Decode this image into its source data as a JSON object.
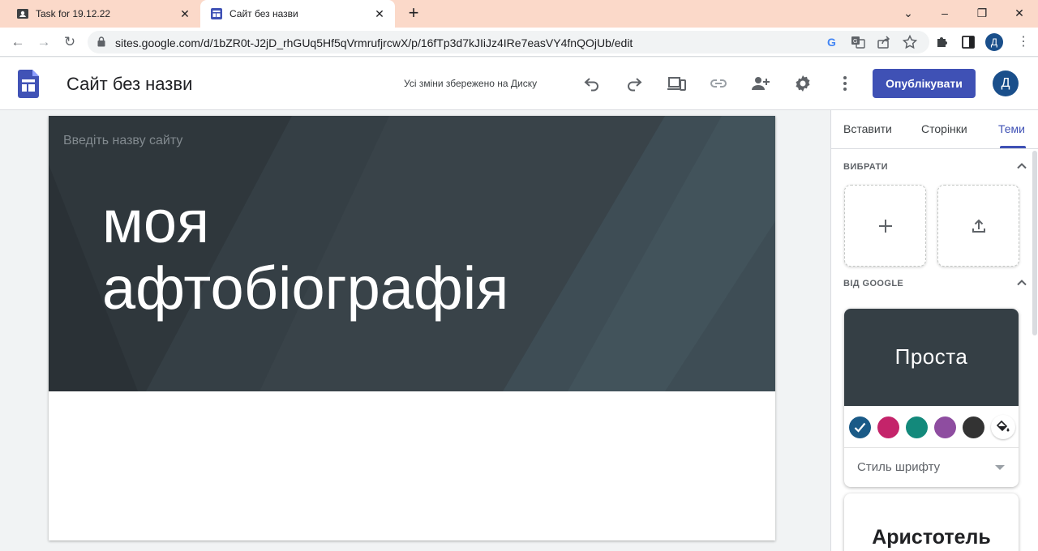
{
  "browser": {
    "tabs": [
      {
        "title": "Task for 19.12.22",
        "active": false
      },
      {
        "title": "Сайт без назви",
        "active": true
      }
    ],
    "url": "sites.google.com/d/1bZR0t-J2jD_rhGUq5Hf5qVrmrufjrcwX/p/16fTp3d7kJIiJz4IRe7easVY4fnQOjUb/edit",
    "profile_initial": "Д"
  },
  "app": {
    "site_title": "Сайт без назви",
    "save_status": "Усі зміни збережено на Диску",
    "publish_label": "Опублікувати",
    "profile_initial": "Д"
  },
  "canvas": {
    "site_name_placeholder": "Введіть назву сайту",
    "hero_line1": "моя",
    "hero_line2": "афтобіографія"
  },
  "panel": {
    "tabs": [
      {
        "label": "Вставити",
        "active": false
      },
      {
        "label": "Сторінки",
        "active": false
      },
      {
        "label": "Теми",
        "active": true
      }
    ],
    "section_choose": "ВИБРАТИ",
    "section_google": "ВІД GOOGLE",
    "themes": [
      {
        "name": "Проста",
        "selected": true,
        "colors": [
          "#1a5a87",
          "#c4246a",
          "#13897b",
          "#8e4da0",
          "#333333"
        ],
        "selected_color_index": 0,
        "font_style_label": "Стиль шрифту"
      },
      {
        "name": "Аристотель",
        "selected": false
      }
    ]
  },
  "colors": {
    "accent": "#3f51b5",
    "hero_bg": "#353f45",
    "tabbar_bg": "#fbd9c9"
  }
}
